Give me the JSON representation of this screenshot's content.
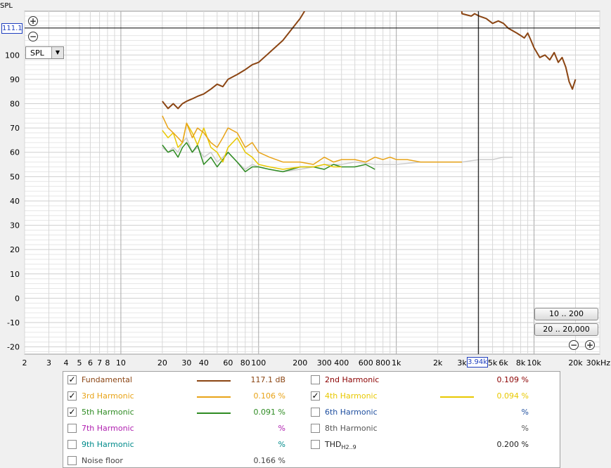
{
  "y_axis_unit": "SPL",
  "y_cursor_readout": "111.1",
  "x_cursor_readout": "3.94k",
  "view_selector": "SPL",
  "range_buttons": [
    "10 .. 200",
    "20 .. 20,000"
  ],
  "colors": {
    "fundamental": "#8b4513",
    "h2": "#8b0000",
    "h3": "#e8a317",
    "h4": "#e8c800",
    "h5": "#2e8b22",
    "h6": "#1f4f9f",
    "h7": "#b020b0",
    "h8": "#555555",
    "h9": "#008b8b",
    "noise": "#cccccc",
    "cursor_blue": "#1f3fbf"
  },
  "legend": [
    {
      "id": "fundamental",
      "label": "Fundamental",
      "checked": true,
      "value": "117.1 dB",
      "swatch": true
    },
    {
      "id": "h2",
      "label": "2nd Harmonic",
      "checked": false,
      "value": "0.109 %",
      "swatch": false
    },
    {
      "id": "h3",
      "label": "3rd Harmonic",
      "checked": true,
      "value": "0.106 %",
      "swatch": true
    },
    {
      "id": "h4",
      "label": "4th Harmonic",
      "checked": true,
      "value": "0.094 %",
      "swatch": true
    },
    {
      "id": "h5",
      "label": "5th Harmonic",
      "checked": true,
      "value": "0.091 %",
      "swatch": true
    },
    {
      "id": "h6",
      "label": "6th Harmonic",
      "checked": false,
      "value": "%",
      "swatch": false
    },
    {
      "id": "h7",
      "label": "7th Harmonic",
      "checked": false,
      "value": "%",
      "swatch": false
    },
    {
      "id": "h8",
      "label": "8th Harmonic",
      "checked": false,
      "value": "%",
      "swatch": false
    },
    {
      "id": "h9",
      "label": "9th Harmonic",
      "checked": false,
      "value": "%",
      "swatch": false
    },
    {
      "id": "thd",
      "label": "THD",
      "label_sub": "H2..9",
      "checked": false,
      "value": "0.200 %",
      "swatch": false
    },
    {
      "id": "noise",
      "label": "Noise floor",
      "checked": false,
      "value": "0.166 %",
      "swatch": false
    }
  ],
  "chart_data": {
    "type": "line",
    "xscale": "log",
    "xlim": [
      2,
      30000
    ],
    "ylim": [
      -23,
      118
    ],
    "ylabel": "SPL",
    "x_ticks": [
      {
        "v": 2,
        "t": "2"
      },
      {
        "v": 3,
        "t": "3"
      },
      {
        "v": 4,
        "t": "4"
      },
      {
        "v": 5,
        "t": "5"
      },
      {
        "v": 6,
        "t": "6"
      },
      {
        "v": 7,
        "t": "7"
      },
      {
        "v": 8,
        "t": "8"
      },
      {
        "v": 10,
        "t": "10"
      },
      {
        "v": 20,
        "t": "20"
      },
      {
        "v": 30,
        "t": "30"
      },
      {
        "v": 40,
        "t": "40"
      },
      {
        "v": 60,
        "t": "60"
      },
      {
        "v": 80,
        "t": "80"
      },
      {
        "v": 100,
        "t": "100"
      },
      {
        "v": 200,
        "t": "200"
      },
      {
        "v": 300,
        "t": "300"
      },
      {
        "v": 400,
        "t": "400"
      },
      {
        "v": 600,
        "t": "600"
      },
      {
        "v": 800,
        "t": "800"
      },
      {
        "v": 1000,
        "t": "1k"
      },
      {
        "v": 2000,
        "t": "2k"
      },
      {
        "v": 3000,
        "t": "3k"
      },
      {
        "v": 5000,
        "t": "5k"
      },
      {
        "v": 6000,
        "t": "6k"
      },
      {
        "v": 8000,
        "t": "8k"
      },
      {
        "v": 10000,
        "t": "10k"
      },
      {
        "v": 20000,
        "t": "20k"
      },
      {
        "v": 30000,
        "t": "30kHz"
      }
    ],
    "y_ticks": [
      100,
      90,
      80,
      70,
      60,
      50,
      40,
      30,
      20,
      10,
      0,
      -10,
      -20
    ],
    "cursor": {
      "x": 3940,
      "y": 111.1
    },
    "series": [
      {
        "id": "fundamental",
        "x": [
          20,
          22,
          24,
          26,
          28,
          30,
          33,
          36,
          40,
          45,
          50,
          55,
          60,
          70,
          80,
          90,
          100,
          120,
          150,
          200,
          250,
          300,
          350,
          400,
          450,
          500,
          550,
          600,
          650,
          700,
          750,
          800,
          900,
          1000,
          1200,
          1500,
          2000,
          3000,
          3500,
          3700,
          4000,
          4500,
          5000,
          5500,
          6000,
          6500,
          7000,
          7500,
          8000,
          8500,
          9000,
          9500,
          10000,
          11000,
          12000,
          13000,
          14000,
          15000,
          16000,
          17000,
          18000,
          19000,
          20000
        ],
        "y": [
          81,
          78,
          80,
          78,
          80,
          81,
          82,
          83,
          84,
          86,
          88,
          87,
          90,
          92,
          94,
          96,
          97,
          101,
          106,
          115,
          124,
          132,
          140,
          148,
          155,
          162,
          170,
          178,
          186,
          194,
          200,
          206,
          214,
          220,
          225,
          225,
          222,
          117,
          116,
          117,
          116,
          115,
          113,
          114,
          113,
          111,
          110,
          109,
          108,
          107,
          109,
          106,
          103,
          99,
          100,
          98,
          101,
          97,
          99,
          95,
          89,
          86,
          90
        ]
      },
      {
        "id": "h3",
        "x": [
          20,
          22,
          24,
          26,
          28,
          30,
          33,
          36,
          40,
          45,
          50,
          55,
          60,
          70,
          80,
          90,
          100,
          120,
          150,
          200,
          250,
          300,
          350,
          400,
          500,
          600,
          700,
          800,
          900,
          1000,
          1200,
          1500,
          2000,
          2500,
          3000
        ],
        "y": [
          75,
          70,
          68,
          66,
          64,
          72,
          66,
          70,
          68,
          64,
          62,
          66,
          70,
          68,
          62,
          64,
          60,
          58,
          56,
          56,
          55,
          58,
          56,
          57,
          57,
          56,
          58,
          57,
          58,
          57,
          57,
          56,
          56,
          56,
          56
        ]
      },
      {
        "id": "h4",
        "x": [
          20,
          22,
          24,
          26,
          28,
          30,
          33,
          36,
          40,
          45,
          50,
          55,
          60,
          70,
          80,
          90,
          100,
          120,
          150,
          200,
          250,
          300,
          350,
          400
        ],
        "y": [
          69,
          66,
          68,
          62,
          64,
          72,
          68,
          63,
          70,
          62,
          60,
          56,
          62,
          66,
          60,
          58,
          55,
          54,
          53,
          54,
          54,
          55,
          54,
          54
        ]
      },
      {
        "id": "h5",
        "x": [
          20,
          22,
          24,
          26,
          28,
          30,
          33,
          36,
          40,
          45,
          50,
          55,
          60,
          70,
          80,
          90,
          100,
          120,
          150,
          200,
          250,
          300,
          350,
          400,
          500,
          600,
          700
        ],
        "y": [
          63,
          60,
          61,
          58,
          62,
          64,
          60,
          63,
          55,
          58,
          54,
          57,
          60,
          56,
          52,
          54,
          54,
          53,
          52,
          54,
          54,
          53,
          55,
          54,
          54,
          55,
          53
        ]
      },
      {
        "id": "noise",
        "x": [
          20,
          22,
          24,
          26,
          28,
          30,
          33,
          36,
          40,
          45,
          50,
          55,
          60,
          70,
          80,
          90,
          100,
          120,
          150,
          200,
          250,
          300,
          400,
          500,
          700,
          1000,
          1500,
          2000,
          3000,
          4000,
          5000,
          6000,
          7000
        ],
        "y": [
          62,
          60,
          62,
          60,
          64,
          66,
          60,
          62,
          58,
          60,
          56,
          58,
          60,
          56,
          53,
          55,
          54,
          53,
          52,
          53,
          54,
          55,
          55,
          56,
          55,
          55,
          56,
          56,
          56,
          57,
          57,
          58,
          58
        ]
      }
    ]
  }
}
